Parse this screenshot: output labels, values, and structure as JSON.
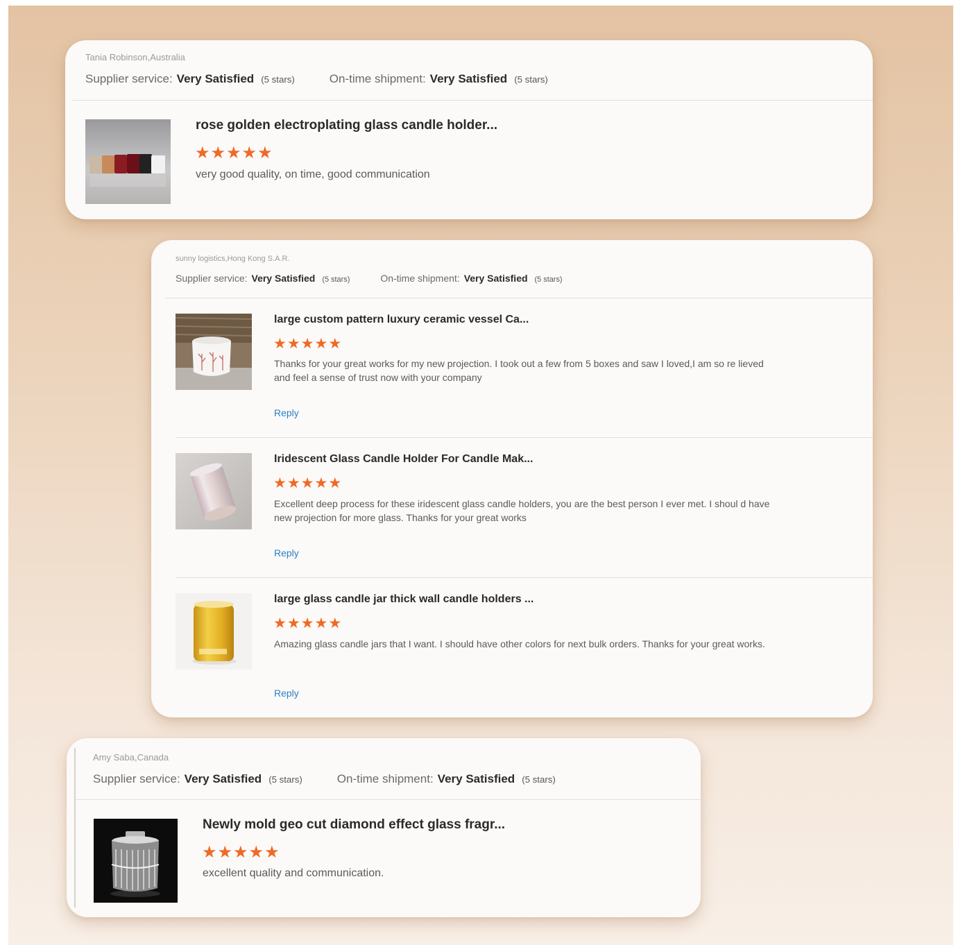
{
  "reviews": [
    {
      "reviewer": "Tania Robinson,Australia",
      "supplier_label": "Supplier service:",
      "supplier_value": "Very Satisfied",
      "supplier_stars": "(5 stars)",
      "shipment_label": "On-time shipment:",
      "shipment_value": "Very Satisfied",
      "shipment_stars": "(5 stars)",
      "products": [
        {
          "title": "rose golden electroplating glass candle holder...",
          "rating": 5,
          "comment": "very good quality, on time, good communication"
        }
      ]
    },
    {
      "reviewer": "sunny logistics,Hong Kong S.A.R.",
      "supplier_label": "Supplier service:",
      "supplier_value": "Very Satisfied",
      "supplier_stars": "(5 stars)",
      "shipment_label": "On-time shipment:",
      "shipment_value": "Very Satisfied",
      "shipment_stars": "(5 stars)",
      "products": [
        {
          "title": "large custom pattern luxury ceramic vessel Ca...",
          "rating": 5,
          "comment": "Thanks for your great works for my new projection. I took out a few from 5 boxes and saw I loved,I am so re lieved and feel a sense of trust now with your company",
          "reply": "Reply"
        },
        {
          "title": "Iridescent Glass Candle Holder For Candle Mak...",
          "rating": 5,
          "comment": "Excellent deep process for these iridescent glass candle holders, you are the best person I ever met. I shoul d have new projection for more glass. Thanks for your great works",
          "reply": "Reply"
        },
        {
          "title": "large glass candle jar thick wall candle holders ...",
          "rating": 5,
          "comment": "Amazing glass candle jars that I want. I should have other colors for next bulk orders. Thanks for your great works.",
          "reply": "Reply"
        }
      ]
    },
    {
      "reviewer": "Amy Saba,Canada",
      "supplier_label": "Supplier service:",
      "supplier_value": "Very Satisfied",
      "supplier_stars": "(5 stars)",
      "shipment_label": "On-time shipment:",
      "shipment_value": "Very Satisfied",
      "shipment_stars": "(5 stars)",
      "products": [
        {
          "title": "Newly mold geo cut diamond effect glass fragr...",
          "rating": 5,
          "comment": "excellent quality and communication."
        }
      ]
    }
  ],
  "icons": {
    "star": "star-icon"
  },
  "colors": {
    "star": "#ef6a24",
    "reply_link": "#2b7fc7",
    "card_bg": "#fbfaf8"
  }
}
